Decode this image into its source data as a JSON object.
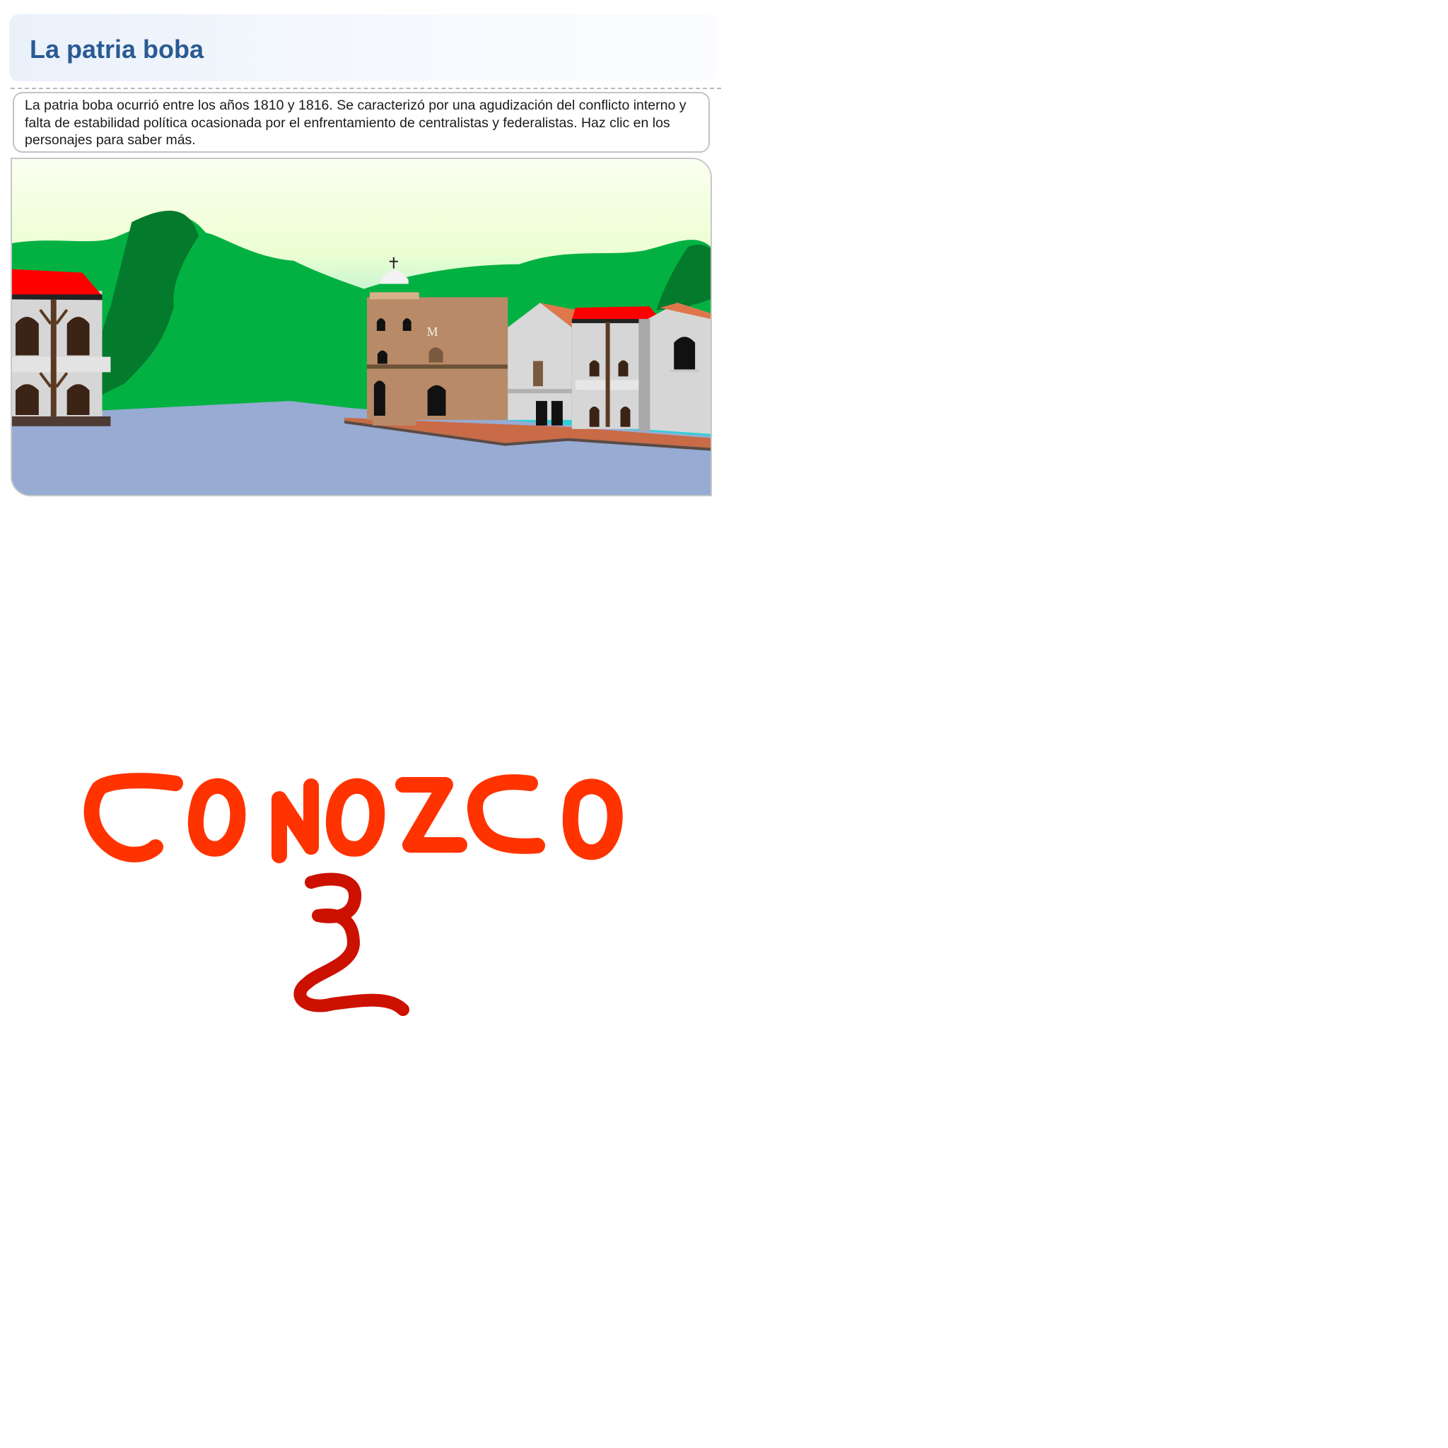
{
  "header": {
    "title": "La patria boba"
  },
  "intro": {
    "text": "La patria boba ocurrió entre los años 1810 y 1816. Se caracterizó por una agudización del conflicto interno y falta de estabilidad política ocasionada por el enfrentamiento de centralistas y federalistas. Haz clic en los personajes para saber más."
  },
  "scene": {
    "church_monogram": "M",
    "colors": {
      "sky_top": "#f4ffd6",
      "sky_bottom": "#2fd0d6",
      "mountain": "#03b142",
      "mountain_shadow": "#047a2c",
      "plaza": "#97abd3",
      "roof_red": "#ff0000",
      "church": "#b98a67"
    }
  },
  "stamp": {
    "word": "CONOZCO",
    "number": "2",
    "word_color": "#ff3300",
    "number_color": "#cc1100"
  }
}
